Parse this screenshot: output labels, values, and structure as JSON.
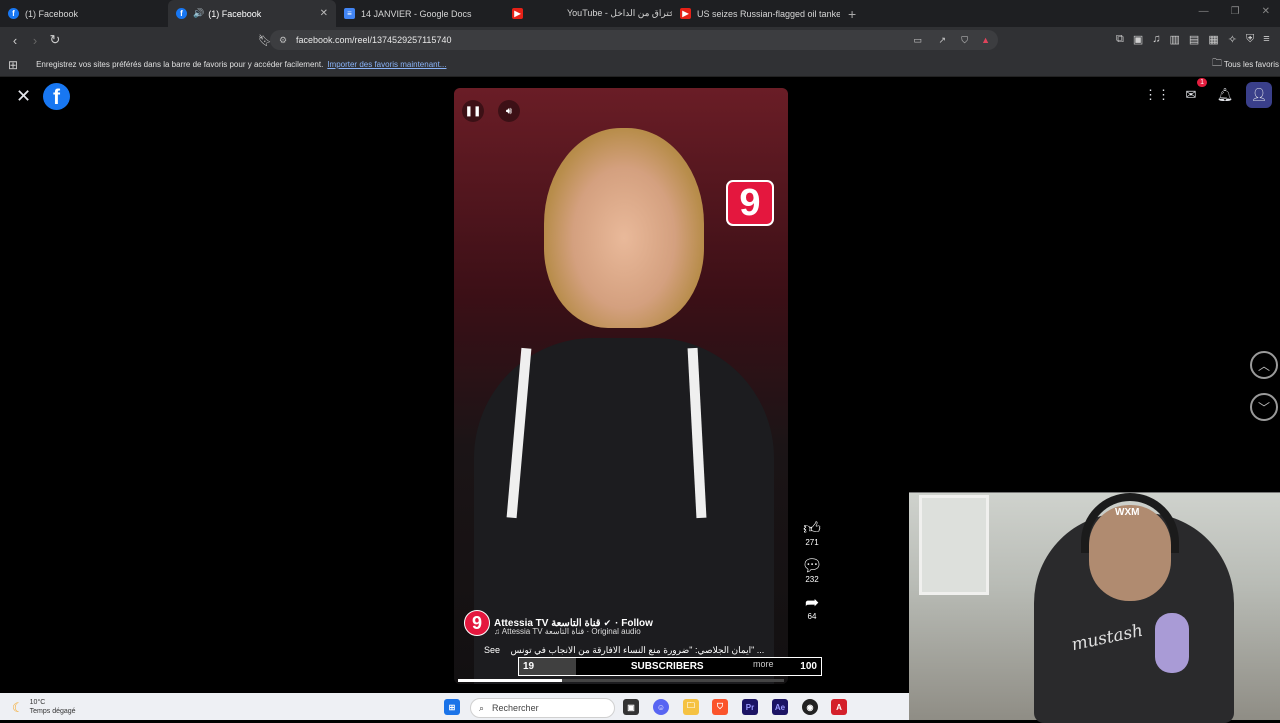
{
  "browser": {
    "tabs": [
      {
        "title": "(1) Facebook",
        "active": false,
        "favicon": "facebook-icon"
      },
      {
        "title": "(1) Facebook",
        "active": true,
        "favicon": "facebook-icon"
      },
      {
        "title": "14 JANVIER - Google Docs",
        "active": false,
        "favicon": "docs-icon"
      },
      {
        "title": "YouTube - اختراق من الداخل",
        "active": false,
        "favicon": "youtube-icon"
      },
      {
        "title": "US seizes Russian-flagged oil tanker",
        "active": false,
        "favicon": "youtube-icon"
      }
    ],
    "new_tab": "+",
    "url": "facebook.com/reel/1374529257115740",
    "bookmarks_prompt": "Enregistrez vos sites préférés dans la barre de favoris pour y accéder facilement.",
    "bookmarks_link": "Importer des favoris maintenant...",
    "all_bookmarks": "Tous les favoris"
  },
  "facebook": {
    "notification_count": "1",
    "reel": {
      "author": "Attessia TV قناة التاسعة",
      "follow": "· Follow",
      "audio": "Attessia TV قناة التاسعة · Original audio",
      "caption": "ايمان الجلاصي: \"ضرورة منع النساء الافارقة من الانجاب في تونس\" ...",
      "see_more": "See",
      "more": "more",
      "likes": "271",
      "comments": "232",
      "shares": "64",
      "progress": 0.32,
      "channel_logo": "9"
    }
  },
  "overlay": {
    "subscriber_current": "19",
    "subscriber_label": "SUBSCRIBERS",
    "subscriber_goal": "100",
    "subscriber_fraction": 0.19,
    "webcam_shirt_text": "mustash",
    "webcam_cap_text": "WXM"
  },
  "taskbar": {
    "temperature": "10°C",
    "weather": "Temps dégagé",
    "search_placeholder": "Rechercher"
  },
  "colors": {
    "facebook_blue": "#1877f2",
    "channel_red": "#e4173e"
  }
}
